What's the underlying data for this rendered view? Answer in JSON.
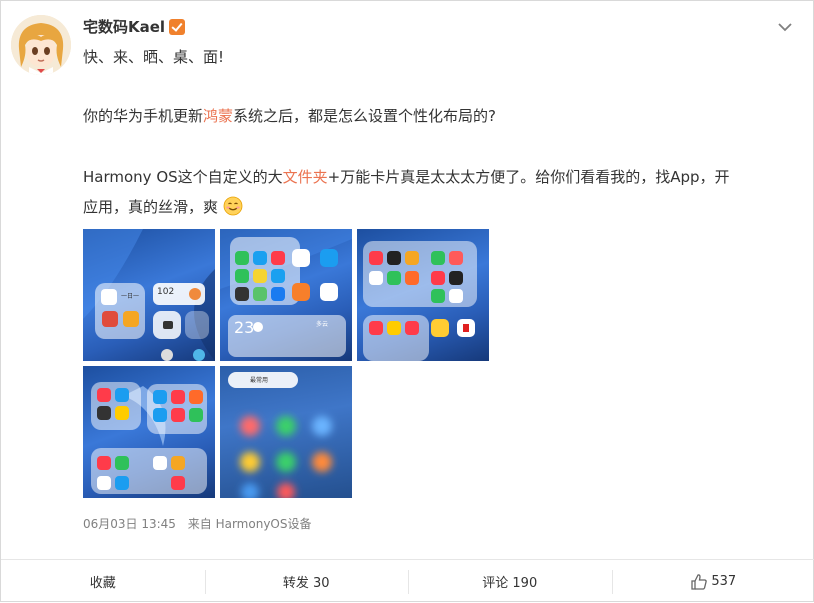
{
  "post": {
    "author": "宅数码Kael",
    "line1": "快、来、晒、桌、面!",
    "para2_prefix": "你的华为手机更新",
    "para2_highlight": "鸿蒙",
    "para2_suffix": "系统之后，都是怎么设置个性化布局的?",
    "para3_line1_a": "Harmony OS这个自定义的大",
    "para3_line1_highlight": "文件夹",
    "para3_line1_b": "+万能卡片真是太太太方便了。给你们看看我的，找App，开",
    "para3_line2": "应用，真的丝滑，爽",
    "timestamp": "06月03日 13:45",
    "source": "来自 HarmonyOS设备",
    "emoji": "smile-emoji",
    "accent_color": "#eb7350",
    "verified_badge_color": "#f0812d"
  },
  "thumbs": {
    "t1": {
      "clock_label": "一日一",
      "temp": "102"
    },
    "t2": {
      "temp": "23",
      "weather": "多云"
    },
    "t3": {},
    "t4": {},
    "t5": {
      "label": "最常用"
    }
  },
  "footer": {
    "favorite": "收藏",
    "repost": "转发 30",
    "comment": "评论 190",
    "like": "537"
  }
}
